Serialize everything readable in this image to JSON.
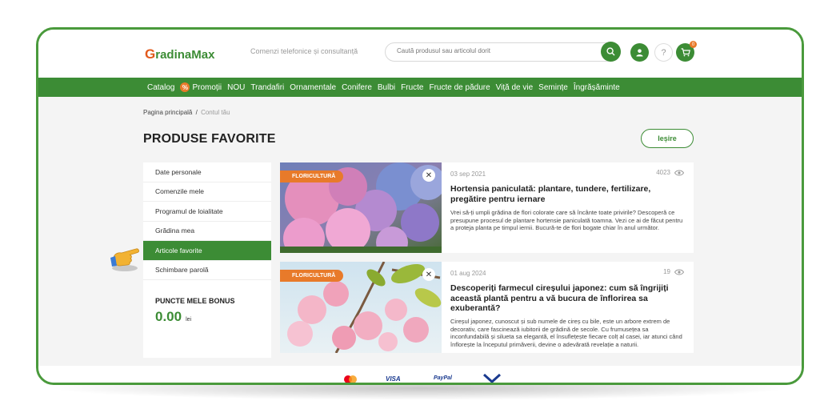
{
  "header": {
    "logo_text": "radinaMax",
    "logo_mark": "G",
    "phone_text": "Comenzi telefonice și consultanță",
    "search_placeholder": "Caută produsul sau articolul dorit",
    "help_label": "?",
    "cart_count": "0"
  },
  "nav": {
    "items": [
      "Catalog",
      "Promoții",
      "NOU",
      "Trandafiri",
      "Ornamentale",
      "Conifere",
      "Bulbi",
      "Fructe",
      "Fructe de pădure",
      "Viță de vie",
      "Semințe",
      "Îngrășăminte"
    ],
    "promo_icon": "%"
  },
  "breadcrumb": {
    "home": "Pagina principală",
    "separator": "/",
    "current": "Contul tău"
  },
  "page": {
    "title": "PRODUSE FAVORITE",
    "logout_label": "Ieșire"
  },
  "sidebar": {
    "items": [
      {
        "label": "Date personale",
        "active": false
      },
      {
        "label": "Comenzile mele",
        "active": false
      },
      {
        "label": "Programul de loialitate",
        "active": false
      },
      {
        "label": "Grădina mea",
        "active": false
      },
      {
        "label": "Articole favorite",
        "active": true
      },
      {
        "label": "Schimbare parolă",
        "active": false
      }
    ],
    "bonus_title": "PUNCTE MELE BONUS",
    "bonus_value": "0.00",
    "bonus_unit": "lei"
  },
  "articles": [
    {
      "tag": "FLORICULTURĂ",
      "date": "03 sep 2021",
      "views": "4023",
      "title": "Hortensia paniculată: plantare, tundere, fertilizare, pregătire pentru iernare",
      "text": "Vrei să-ți umpli grădina de flori colorate care să încânte toate privirile? Descoperă ce presupune procesul de plantare hortensie paniculată toamna. Vezi ce ai de făcut pentru a proteja planta pe timpul iernii. Bucură-te de flori bogate chiar în anul următor."
    },
    {
      "tag": "FLORICULTURĂ",
      "date": "01 aug 2024",
      "views": "19",
      "title": "Descoperiți farmecul cireșului japonez: cum să îngrijiți această plantă pentru a vă bucura de înflorirea sa exuberantă?",
      "text": "Cireșul japonez, cunoscut și sub numele de cireș cu bile, este un arbore extrem de decorativ, care fascinează iubitorii de grădină de secole. Cu frumusețea sa inconfundabilă și silueta sa elegantă, el însuflețește fiecare colț al casei, iar atunci când înflorește la începutul primăverii, devine o adevărată revelație a naturii."
    }
  ],
  "footer": {
    "payments": [
      "VISA",
      "PayPal"
    ]
  },
  "colors": {
    "brand_green": "#3c8c35",
    "accent_orange": "#e87a2a",
    "frame_green": "#4a9a3c"
  },
  "icons": {
    "search": "search-icon",
    "user": "user-icon",
    "help": "help-icon",
    "cart": "cart-icon",
    "close": "close-icon",
    "eye": "eye-icon",
    "hand": "pointing-hand-icon"
  }
}
